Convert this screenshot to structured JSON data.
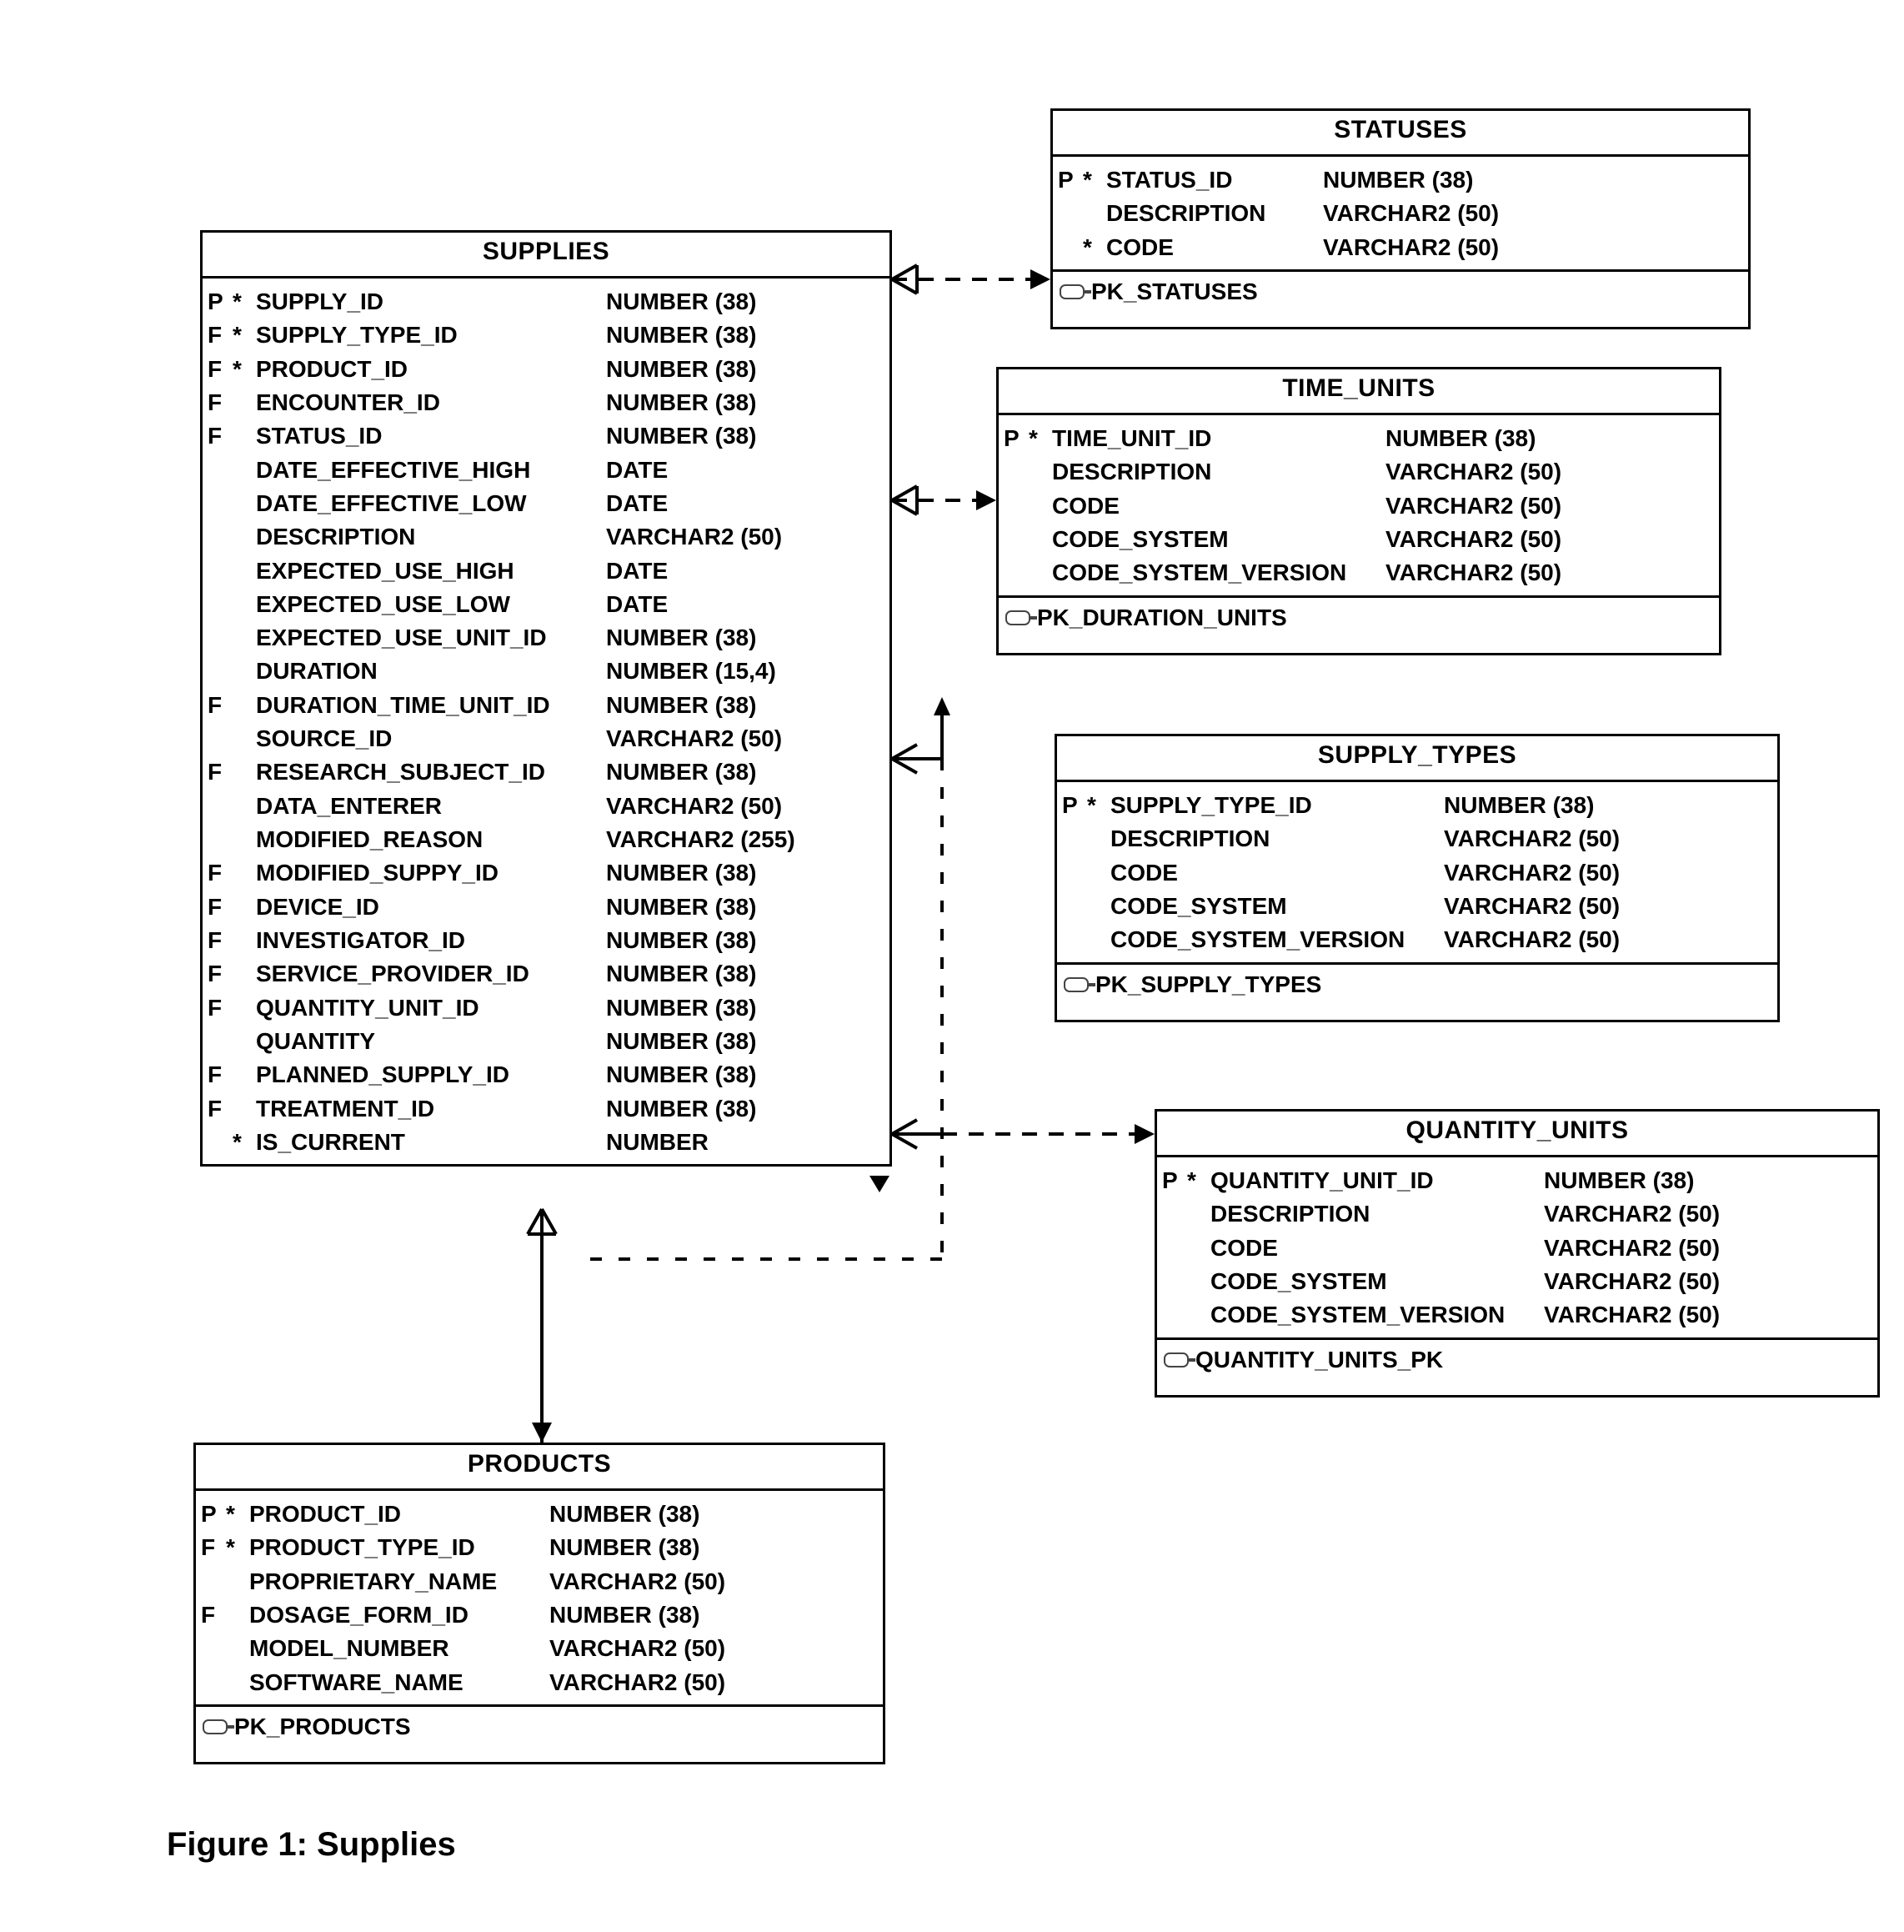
{
  "caption": "Figure 1: Supplies",
  "entities": {
    "supplies": {
      "title": "SUPPLIES",
      "columns": [
        {
          "kf": "P",
          "req": "*",
          "name": "SUPPLY_ID",
          "type": "NUMBER (38)"
        },
        {
          "kf": "F",
          "req": "*",
          "name": "SUPPLY_TYPE_ID",
          "type": "NUMBER (38)"
        },
        {
          "kf": "F",
          "req": "*",
          "name": "PRODUCT_ID",
          "type": "NUMBER (38)"
        },
        {
          "kf": "F",
          "req": "",
          "name": "ENCOUNTER_ID",
          "type": "NUMBER (38)"
        },
        {
          "kf": "F",
          "req": "",
          "name": "STATUS_ID",
          "type": "NUMBER (38)"
        },
        {
          "kf": "",
          "req": "",
          "name": "DATE_EFFECTIVE_HIGH",
          "type": "DATE"
        },
        {
          "kf": "",
          "req": "",
          "name": "DATE_EFFECTIVE_LOW",
          "type": "DATE"
        },
        {
          "kf": "",
          "req": "",
          "name": "DESCRIPTION",
          "type": "VARCHAR2 (50)"
        },
        {
          "kf": "",
          "req": "",
          "name": "EXPECTED_USE_HIGH",
          "type": "DATE"
        },
        {
          "kf": "",
          "req": "",
          "name": "EXPECTED_USE_LOW",
          "type": "DATE"
        },
        {
          "kf": "",
          "req": "",
          "name": "EXPECTED_USE_UNIT_ID",
          "type": "NUMBER (38)"
        },
        {
          "kf": "",
          "req": "",
          "name": "DURATION",
          "type": "NUMBER (15,4)"
        },
        {
          "kf": "F",
          "req": "",
          "name": "DURATION_TIME_UNIT_ID",
          "type": "NUMBER (38)"
        },
        {
          "kf": "",
          "req": "",
          "name": "SOURCE_ID",
          "type": "VARCHAR2 (50)"
        },
        {
          "kf": "F",
          "req": "",
          "name": "RESEARCH_SUBJECT_ID",
          "type": "NUMBER (38)"
        },
        {
          "kf": "",
          "req": "",
          "name": "DATA_ENTERER",
          "type": "VARCHAR2 (50)"
        },
        {
          "kf": "",
          "req": "",
          "name": "MODIFIED_REASON",
          "type": "VARCHAR2 (255)"
        },
        {
          "kf": "F",
          "req": "",
          "name": "MODIFIED_SUPPY_ID",
          "type": "NUMBER (38)"
        },
        {
          "kf": "F",
          "req": "",
          "name": "DEVICE_ID",
          "type": "NUMBER (38)"
        },
        {
          "kf": "F",
          "req": "",
          "name": "INVESTIGATOR_ID",
          "type": "NUMBER (38)"
        },
        {
          "kf": "F",
          "req": "",
          "name": "SERVICE_PROVIDER_ID",
          "type": "NUMBER (38)"
        },
        {
          "kf": "F",
          "req": "",
          "name": "QUANTITY_UNIT_ID",
          "type": "NUMBER (38)"
        },
        {
          "kf": "",
          "req": "",
          "name": "QUANTITY",
          "type": "NUMBER (38)"
        },
        {
          "kf": "F",
          "req": "",
          "name": "PLANNED_SUPPLY_ID",
          "type": "NUMBER (38)"
        },
        {
          "kf": "F",
          "req": "",
          "name": "TREATMENT_ID",
          "type": "NUMBER (38)"
        },
        {
          "kf": "",
          "req": "*",
          "name": "IS_CURRENT",
          "type": "NUMBER"
        }
      ]
    },
    "statuses": {
      "title": "STATUSES",
      "columns": [
        {
          "kf": "P",
          "req": "*",
          "name": "STATUS_ID",
          "type": "NUMBER (38)"
        },
        {
          "kf": "",
          "req": "",
          "name": "DESCRIPTION",
          "type": "VARCHAR2 (50)"
        },
        {
          "kf": "",
          "req": "*",
          "name": "CODE",
          "type": "VARCHAR2 (50)"
        }
      ],
      "pk": "PK_STATUSES"
    },
    "time_units": {
      "title": "TIME_UNITS",
      "columns": [
        {
          "kf": "P",
          "req": "*",
          "name": "TIME_UNIT_ID",
          "type": "NUMBER (38)"
        },
        {
          "kf": "",
          "req": "",
          "name": "DESCRIPTION",
          "type": "VARCHAR2 (50)"
        },
        {
          "kf": "",
          "req": "",
          "name": "CODE",
          "type": "VARCHAR2 (50)"
        },
        {
          "kf": "",
          "req": "",
          "name": "CODE_SYSTEM",
          "type": "VARCHAR2 (50)"
        },
        {
          "kf": "",
          "req": "",
          "name": "CODE_SYSTEM_VERSION",
          "type": "VARCHAR2 (50)"
        }
      ],
      "pk": "PK_DURATION_UNITS"
    },
    "supply_types": {
      "title": "SUPPLY_TYPES",
      "columns": [
        {
          "kf": "P",
          "req": "*",
          "name": "SUPPLY_TYPE_ID",
          "type": "NUMBER (38)"
        },
        {
          "kf": "",
          "req": "",
          "name": "DESCRIPTION",
          "type": "VARCHAR2 (50)"
        },
        {
          "kf": "",
          "req": "",
          "name": "CODE",
          "type": "VARCHAR2 (50)"
        },
        {
          "kf": "",
          "req": "",
          "name": "CODE_SYSTEM",
          "type": "VARCHAR2 (50)"
        },
        {
          "kf": "",
          "req": "",
          "name": "CODE_SYSTEM_VERSION",
          "type": "VARCHAR2 (50)"
        }
      ],
      "pk": "PK_SUPPLY_TYPES"
    },
    "quantity_units": {
      "title": "QUANTITY_UNITS",
      "columns": [
        {
          "kf": "P",
          "req": "*",
          "name": "QUANTITY_UNIT_ID",
          "type": "NUMBER (38)"
        },
        {
          "kf": "",
          "req": "",
          "name": "DESCRIPTION",
          "type": "VARCHAR2 (50)"
        },
        {
          "kf": "",
          "req": "",
          "name": "CODE",
          "type": "VARCHAR2 (50)"
        },
        {
          "kf": "",
          "req": "",
          "name": "CODE_SYSTEM",
          "type": "VARCHAR2 (50)"
        },
        {
          "kf": "",
          "req": "",
          "name": "CODE_SYSTEM_VERSION",
          "type": "VARCHAR2 (50)"
        }
      ],
      "pk": "QUANTITY_UNITS_PK"
    },
    "products": {
      "title": "PRODUCTS",
      "columns": [
        {
          "kf": "P",
          "req": "*",
          "name": "PRODUCT_ID",
          "type": "NUMBER (38)"
        },
        {
          "kf": "F",
          "req": "*",
          "name": "PRODUCT_TYPE_ID",
          "type": "NUMBER (38)"
        },
        {
          "kf": "",
          "req": "",
          "name": "PROPRIETARY_NAME",
          "type": "VARCHAR2 (50)"
        },
        {
          "kf": "F",
          "req": "",
          "name": "DOSAGE_FORM_ID",
          "type": "NUMBER (38)"
        },
        {
          "kf": "",
          "req": "",
          "name": "MODEL_NUMBER",
          "type": "VARCHAR2 (50)"
        },
        {
          "kf": "",
          "req": "",
          "name": "SOFTWARE_NAME",
          "type": "VARCHAR2 (50)"
        }
      ],
      "pk": "PK_PRODUCTS"
    }
  }
}
